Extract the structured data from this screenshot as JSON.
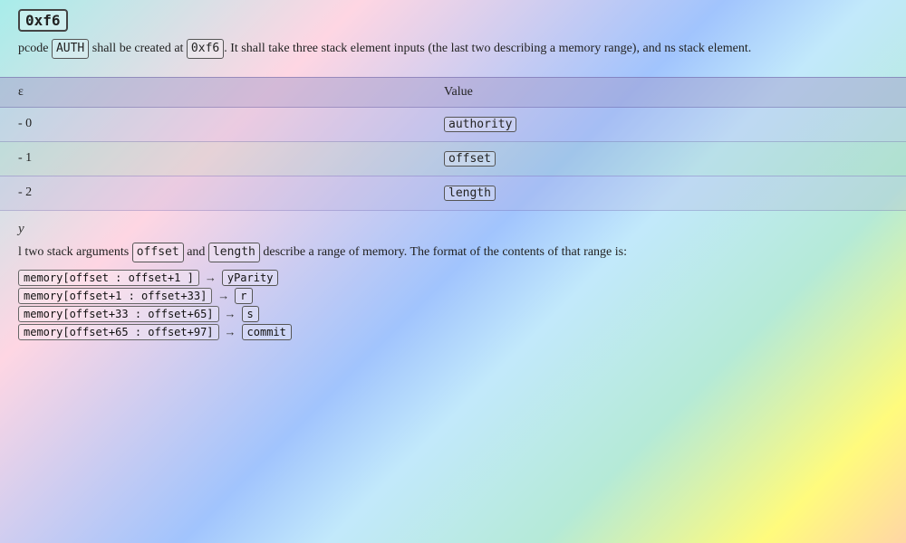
{
  "heading": {
    "opcode_value": "0xf6",
    "auth_badge": "AUTH",
    "description_before": "pcode ",
    "auth_inline": "AUTH",
    "description_after": " shall be created at ",
    "opcode_inline": "0xf6",
    "description_rest": ". It shall take three stack element inputs (the last two describing a memory range), and ns stack element."
  },
  "table": {
    "col1_header": "ε",
    "col2_header": "Value",
    "rows": [
      {
        "key": "- 0",
        "value": "authority"
      },
      {
        "key": "- 1",
        "value": "offset"
      },
      {
        "key": "- 2",
        "value": "length"
      }
    ]
  },
  "bottom": {
    "section_label": "y",
    "prose_before": "l two stack arguments ",
    "offset_inline": "offset",
    "prose_middle": " and ",
    "length_inline": "length",
    "prose_after": " describe a range of memory. The format of the contents of that range is:",
    "memory_lines": [
      {
        "code": "memory[offset : offset+1 ]",
        "arrow": "→",
        "value": "yParity"
      },
      {
        "code": "memory[offset+1 : offset+33]",
        "arrow": "→",
        "value": "r"
      },
      {
        "code": "memory[offset+33 : offset+65]",
        "arrow": "→",
        "value": "s"
      },
      {
        "code": "memory[offset+65 : offset+97]",
        "arrow": "→",
        "value": "commit"
      }
    ]
  }
}
